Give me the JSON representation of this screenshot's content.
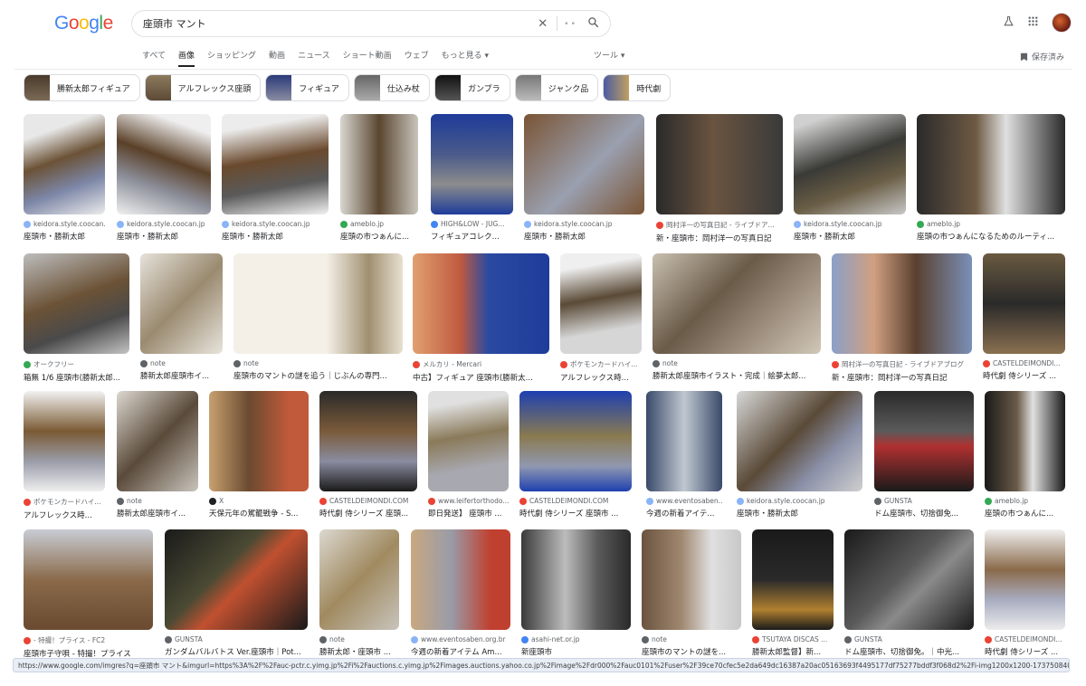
{
  "logo": "Google",
  "search": {
    "value": "座頭市 マント"
  },
  "nav": {
    "tabs": [
      "すべて",
      "画像",
      "ショッピング",
      "動画",
      "ニュース",
      "ショート動画",
      "ウェブ",
      "もっと見る ▾"
    ],
    "tools": "ツール ▾",
    "saved": "保存済み"
  },
  "chips": [
    "勝新太郎フィギュア",
    "アルフレックス座頭",
    "フィギュア",
    "仕込み杖",
    "ガンプラ",
    "ジャンク品",
    "時代劇"
  ],
  "rows": [
    [
      {
        "src": "keidora.style.coocan...",
        "title": "座頭市・勝新太郎"
      },
      {
        "src": "keidora.style.coocan.jp",
        "title": "座頭市・勝新太郎"
      },
      {
        "src": "keidora.style.coocan.jp",
        "title": "座頭市・勝新太郎"
      },
      {
        "src": "ameblo.jp",
        "title": "座頭の市つぁんに..."
      },
      {
        "src": "HIGH&LOW - JUG...",
        "title": "フィギュアコレク..."
      },
      {
        "src": "keidora.style.coocan.jp",
        "title": "座頭市・勝新太郎"
      },
      {
        "src": "岡村洋一の写真日記 - ライブドア...",
        "title": "新・座頭市：岡村洋一の写真日記"
      },
      {
        "src": "keidora.style.coocan.jp",
        "title": "座頭市・勝新太郎"
      },
      {
        "src": "ameblo.jp",
        "title": "座頭の市つぁんになるためのルーティ..."
      }
    ],
    [
      {
        "src": "オークフリー",
        "title": "箱無 1/6 座頭市(勝新太郎..."
      },
      {
        "src": "note",
        "title": "勝新太郎座頭市イ..."
      },
      {
        "src": "note",
        "title": "座頭市のマントの謎を追う｜じぶんの専門..."
      },
      {
        "src": "メルカリ - Mercari",
        "title": "中古】フィギュア 座頭市(勝新太..."
      },
      {
        "src": "ポケモンカードハイ...",
        "title": "アルフレックス時..."
      },
      {
        "src": "note",
        "title": "勝新太郎座頭市イラスト・完成｜絵夢太郎..."
      },
      {
        "src": "岡村洋一の写真日記 - ライブドアブログ",
        "title": "新・座頭市：岡村洋一の写真日記"
      },
      {
        "src": "CASTELDEIMONDI...",
        "title": "時代劇 侍シリーズ ..."
      }
    ],
    [
      {
        "src": "ポケモンカードハイ...",
        "title": "アルフレックス時..."
      },
      {
        "src": "note",
        "title": "勝新太郎座頭市イ..."
      },
      {
        "src": "X",
        "title": "天保元年の駕籠戦争 - S..."
      },
      {
        "src": "CASTELDEIMONDI.COM",
        "title": "時代劇 侍シリーズ 座頭..."
      },
      {
        "src": "www.leifertorthodo...",
        "title": "即日発送】 座頭市 ..."
      },
      {
        "src": "CASTELDEIMONDI.COM",
        "title": "時代劇 侍シリーズ 座頭市 ..."
      },
      {
        "src": "www.eventosaben....",
        "title": "今週の新着アイテ..."
      },
      {
        "src": "keidora.style.coocan.jp",
        "title": "座頭市・勝新太郎"
      },
      {
        "src": "GUNSTA",
        "title": "ドム座頭市、切捨御免..."
      },
      {
        "src": "ameblo.jp",
        "title": "座頭の市つぁんに..."
      }
    ],
    [
      {
        "src": "- 特撮！プライス - FC2",
        "title": "座頭市子守唄 - 特撮！プライス"
      },
      {
        "src": "GUNSTA",
        "title": "ガンダムバルバトス Ver.座頭市｜Pot..."
      },
      {
        "src": "note",
        "title": "勝新太郎・座頭市 ..."
      },
      {
        "src": "www.eventosaben.org.br",
        "title": "今週の新着アイテム Am..."
      },
      {
        "src": "asahi-net.or.jp",
        "title": "新座頭市"
      },
      {
        "src": "note",
        "title": "座頭市のマントの謎を..."
      },
      {
        "src": "TSUTAYA DISCAS ...",
        "title": "勝新太郎監督】新..."
      },
      {
        "src": "GUNSTA",
        "title": "ドム座頭市、切捨御免。｜中光..."
      },
      {
        "src": "CASTELDEIMONDI...",
        "title": "時代劇 侍シリーズ ..."
      }
    ]
  ],
  "status_url": "https://www.google.com/imgres?q=座頭市 マント&imgurl=https%3A%2F%2Fauc-pctr.c.yimg.jp%2Fi%2Fauctions.c.yimg.jp%2Fimages.auctions.yahoo.co.jp%2Fimage%2Fdr000%2Fauc0101%2Fuser%2F39ce70cfec5e2da649dc16387a20ac05163693f4495177df75277bddf3f068d2%2Fi-img1200x1200-17375084059562dtk64c76..."
}
